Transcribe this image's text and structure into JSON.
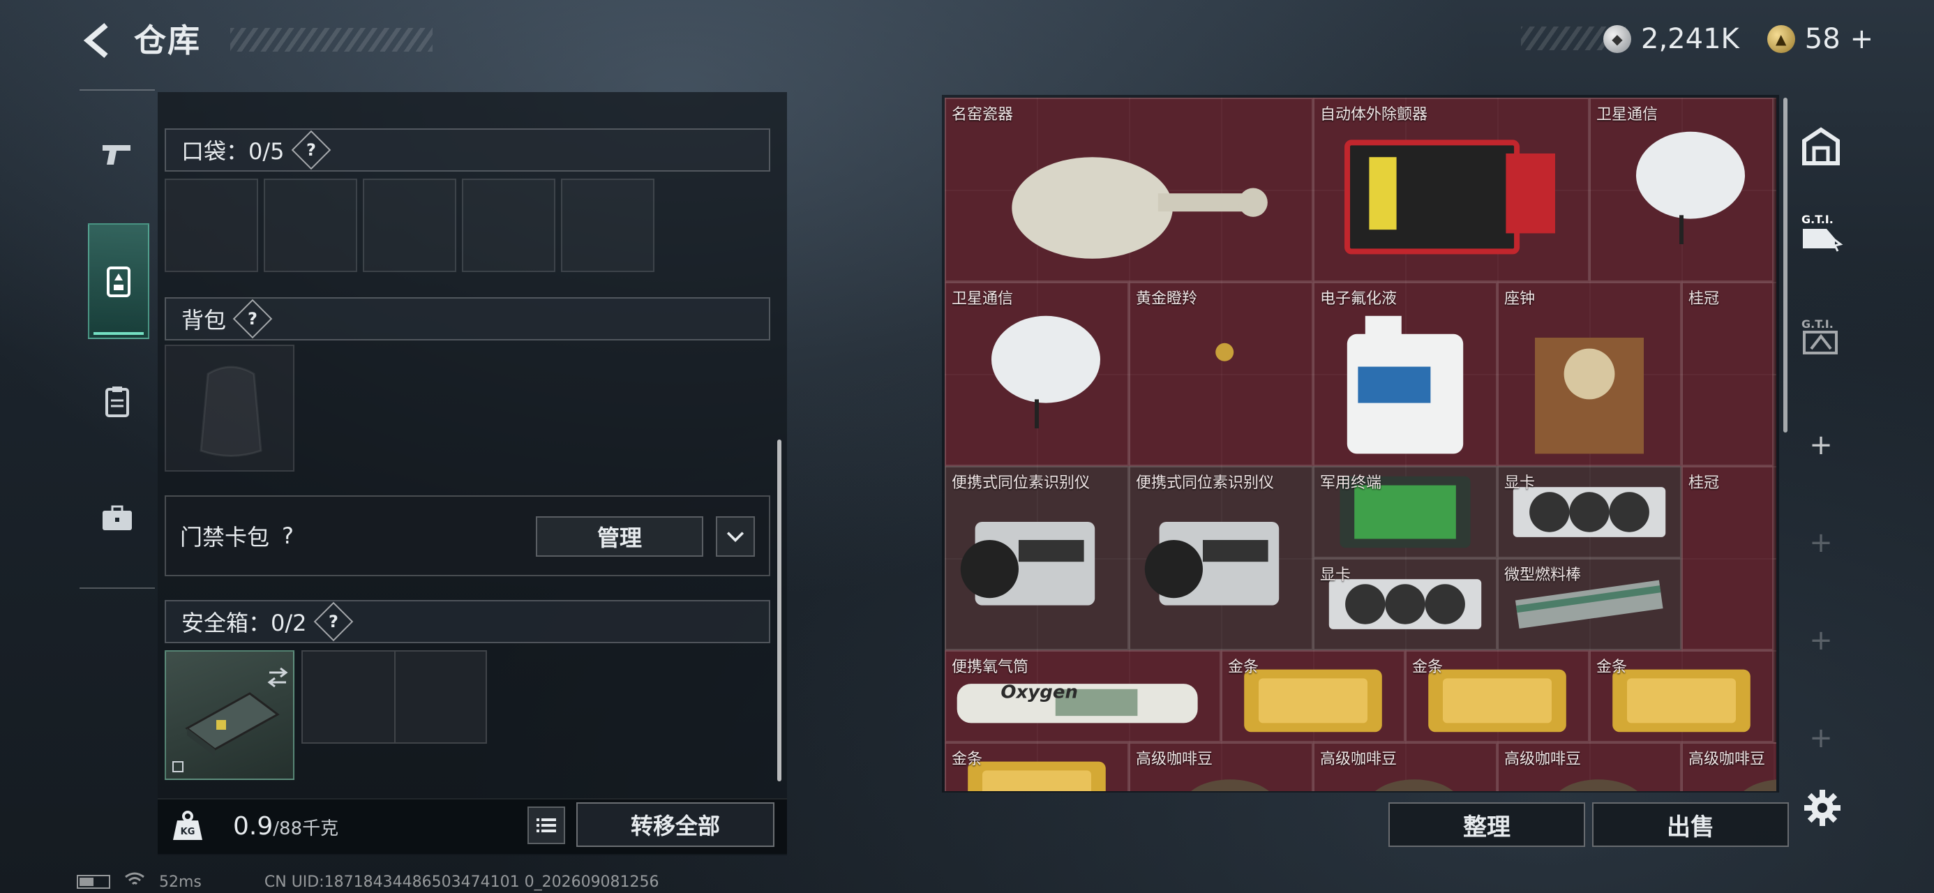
{
  "header": {
    "title": "仓库",
    "currency": [
      {
        "icon": "silver-coin-icon",
        "value": "2,241K"
      },
      {
        "icon": "gold-coin-icon",
        "value": "58",
        "add_label": "+"
      }
    ]
  },
  "left_nav": {
    "items": [
      {
        "icon": "pistol-icon"
      },
      {
        "icon": "equipment-icon",
        "active": true
      },
      {
        "icon": "clipboard-icon"
      },
      {
        "icon": "briefcase-icon"
      }
    ]
  },
  "loadout": {
    "pockets": {
      "label": "口袋：",
      "count": "0/5",
      "help": "?"
    },
    "backpack": {
      "label": "背包",
      "help": "?"
    },
    "keycard": {
      "label": "门禁卡包",
      "help": "?",
      "manage_label": "管理"
    },
    "safe_box": {
      "label": "安全箱：",
      "count": "0/2",
      "help": "?"
    },
    "weight": {
      "current": "0.9",
      "max": "/88千克"
    },
    "transfer_all_label": "转移全部"
  },
  "storage": {
    "items": [
      {
        "name": "名窑瓷器",
        "kind": "vase"
      },
      {
        "name": "自动体外除颤器",
        "kind": "aed"
      },
      {
        "name": "卫星通信",
        "kind": "dish"
      },
      {
        "name": "卫星通信",
        "kind": "dish"
      },
      {
        "name": "黄金瞪羚",
        "kind": "gazelle"
      },
      {
        "name": "电子氟化液",
        "kind": "jug"
      },
      {
        "name": "座钟",
        "kind": "clock"
      },
      {
        "name": "桂冠",
        "kind": "laurel"
      },
      {
        "name": "便携式同位素识别仪",
        "kind": "scanner"
      },
      {
        "name": "便携式同位素识别仪",
        "kind": "scanner"
      },
      {
        "name": "军用终端",
        "kind": "terminal"
      },
      {
        "name": "显卡",
        "kind": "gpu"
      },
      {
        "name": "桂冠",
        "kind": "laurel"
      },
      {
        "name": "显卡",
        "kind": "gpu"
      },
      {
        "name": "微型燃料棒",
        "kind": "fuelrod"
      },
      {
        "name": "便携氧气筒",
        "kind": "oxygen",
        "print": "Oxygen"
      },
      {
        "name": "金条",
        "kind": "goldbar"
      },
      {
        "name": "金条",
        "kind": "goldbar"
      },
      {
        "name": "金条",
        "kind": "goldbar"
      },
      {
        "name": "金条",
        "kind": "goldbar"
      },
      {
        "name": "高级咖啡豆",
        "kind": "coffee"
      },
      {
        "name": "高级咖啡豆",
        "kind": "coffee"
      },
      {
        "name": "高级咖啡豆",
        "kind": "coffee"
      },
      {
        "name": "高级咖啡豆",
        "kind": "coffee"
      }
    ],
    "sort_label": "整理",
    "sell_label": "出售"
  },
  "side_tabs": [
    {
      "icon": "storage-tab-icon"
    },
    {
      "icon": "gti-tab-icon"
    },
    {
      "icon": "gti-alt-tab-icon"
    }
  ],
  "side_add_label": "+",
  "status_bar": {
    "ping": "52ms",
    "uid": "CN UID:18718434486503474101 0_202609081256"
  },
  "colors": {
    "valuable_item_bg": "#6e2834",
    "grid_bg": "#3f1e24",
    "active_accent": "#74e0c3"
  }
}
